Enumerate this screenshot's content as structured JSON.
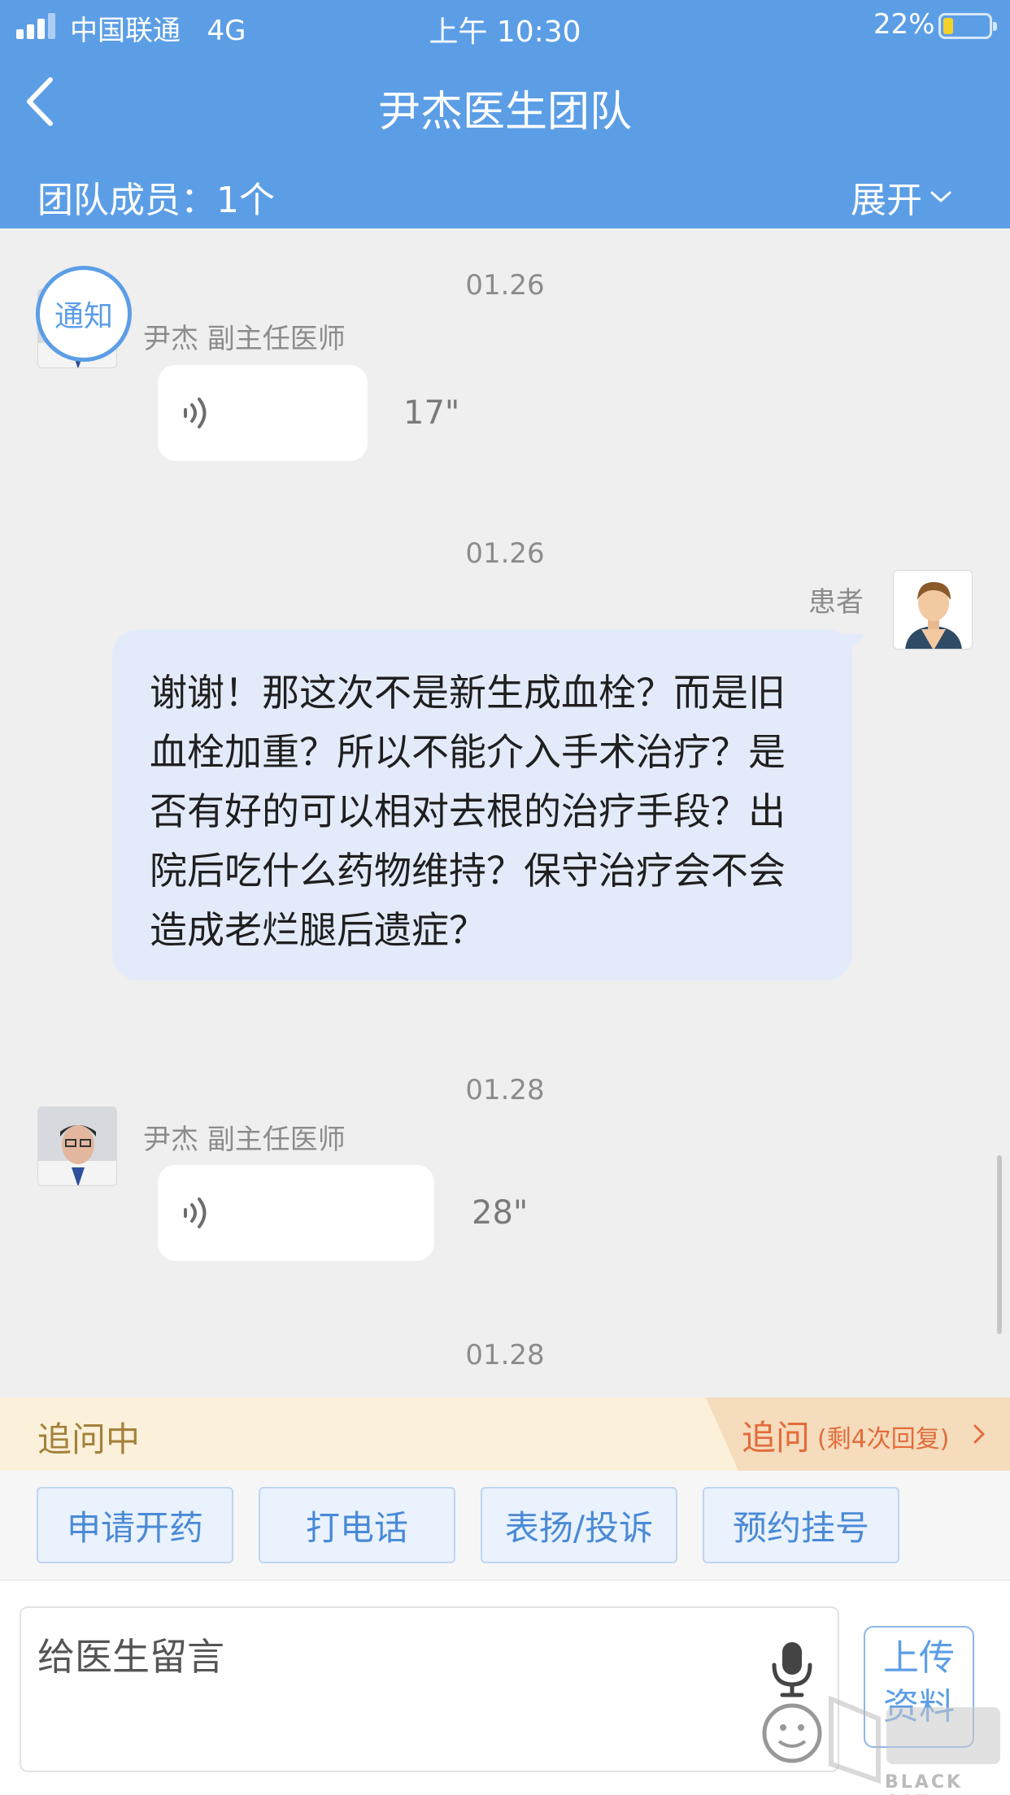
{
  "status_bar": {
    "carrier": "中国联通",
    "network": "4G",
    "time": "上午 10:30",
    "battery_percent": "22%",
    "battery_level": 0.22
  },
  "header": {
    "title": "尹杰医生团队",
    "team_members_label": "团队成员：1个",
    "expand_label": "展开",
    "colors": {
      "primary": "#5c9ee6"
    }
  },
  "messages": [
    {
      "date": "01.26",
      "sender": "尹杰 副主任医师",
      "type": "voice",
      "duration": "17\"",
      "badge": "通知"
    },
    {
      "date": "01.26",
      "sender": "患者",
      "type": "text",
      "text": "谢谢！那这次不是新生成血栓？而是旧血栓加重？所以不能介入手术治疗？是否有好的可以相对去根的治疗手段？出院后吃什么药物维持？保守治疗会不会造成老烂腿后遗症？"
    },
    {
      "date": "01.28",
      "sender": "尹杰 副主任医师",
      "type": "voice",
      "duration": "28\""
    },
    {
      "date": "01.28"
    }
  ],
  "followup": {
    "status": "追问中",
    "button_label": "追问",
    "remaining": "(剩4次回复)"
  },
  "actions": [
    "申请开药",
    "打电话",
    "表扬/投诉",
    "预约挂号"
  ],
  "input": {
    "placeholder": "给医生留言",
    "upload_label": "上传资料"
  },
  "watermark": {
    "text": "BLACK CAT"
  }
}
